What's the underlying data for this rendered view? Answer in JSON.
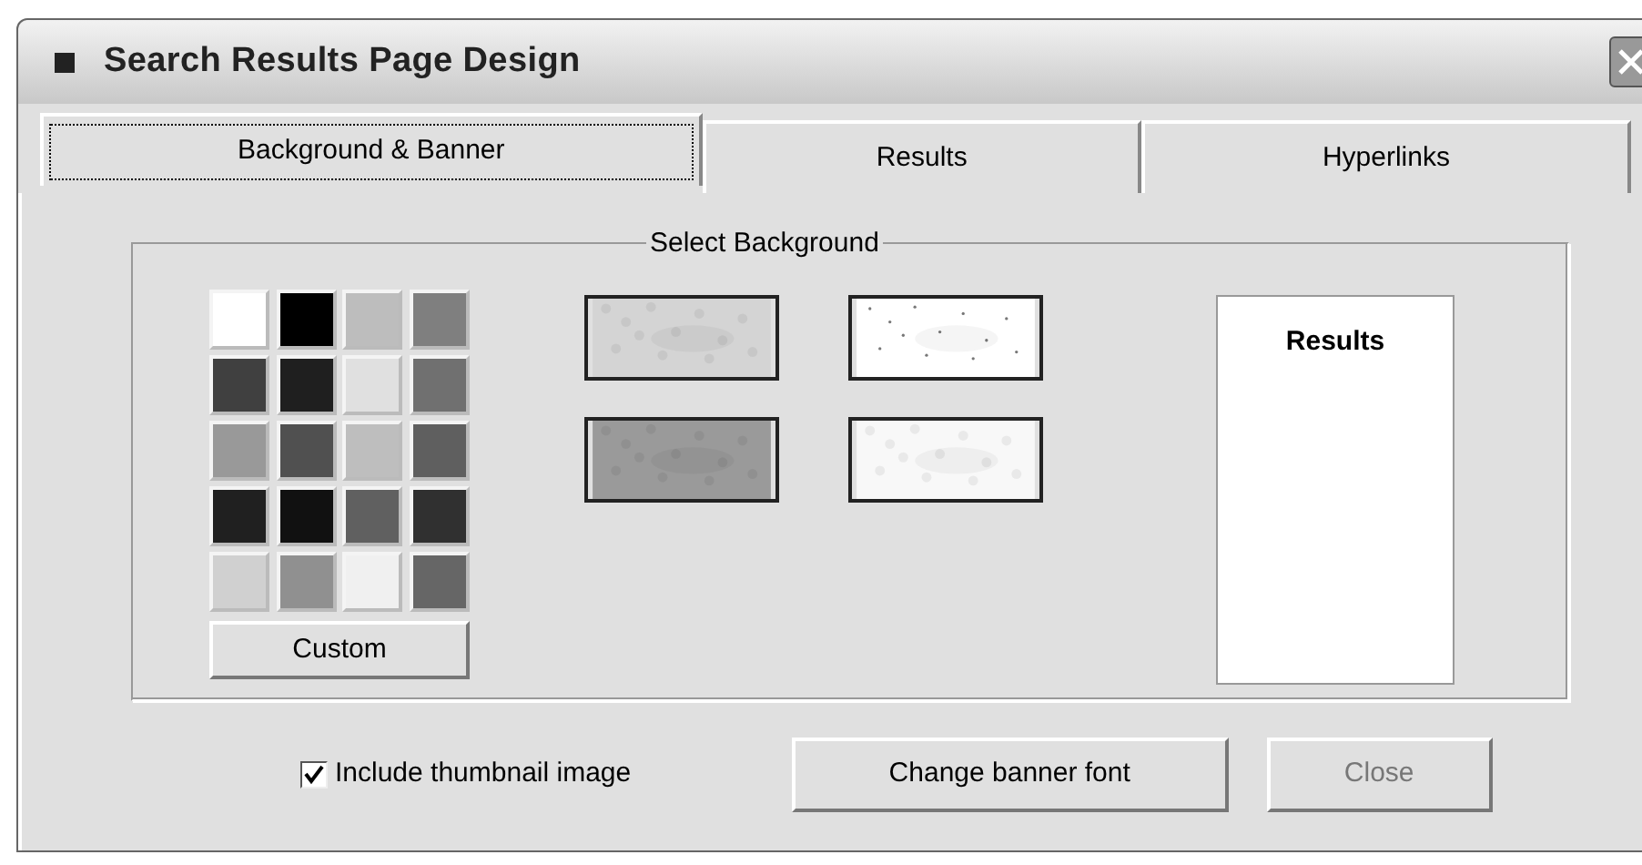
{
  "window": {
    "title": "Search Results Page Design"
  },
  "tabs": [
    {
      "label": "Background & Banner",
      "selected": true
    },
    {
      "label": "Results",
      "selected": false
    },
    {
      "label": "Hyperlinks",
      "selected": false
    }
  ],
  "group": {
    "title": "Select Background"
  },
  "swatches": [
    {
      "color": "#ffffff"
    },
    {
      "color": "#000000"
    },
    {
      "color": "#bdbdbd"
    },
    {
      "color": "#7f7f7f"
    },
    {
      "color": "#404040"
    },
    {
      "color": "#1f1f1f"
    },
    {
      "color": "#e0e0e0"
    },
    {
      "color": "#707070"
    },
    {
      "color": "#999999"
    },
    {
      "color": "#505050"
    },
    {
      "color": "#bebebe"
    },
    {
      "color": "#5f5f5f"
    },
    {
      "color": "#202020"
    },
    {
      "color": "#111111"
    },
    {
      "color": "#606060"
    },
    {
      "color": "#303030"
    },
    {
      "color": "#d0d0d0"
    },
    {
      "color": "#909090"
    },
    {
      "color": "#f0f0f0"
    },
    {
      "color": "#666666"
    }
  ],
  "custom_button": "Custom",
  "preview": {
    "title": "Results"
  },
  "thumbnail_checkbox": {
    "label": "Include thumbnail image",
    "checked": true
  },
  "buttons": [
    {
      "label": "Change banner font",
      "disabled": false
    },
    {
      "label": "Close",
      "disabled": true
    }
  ]
}
